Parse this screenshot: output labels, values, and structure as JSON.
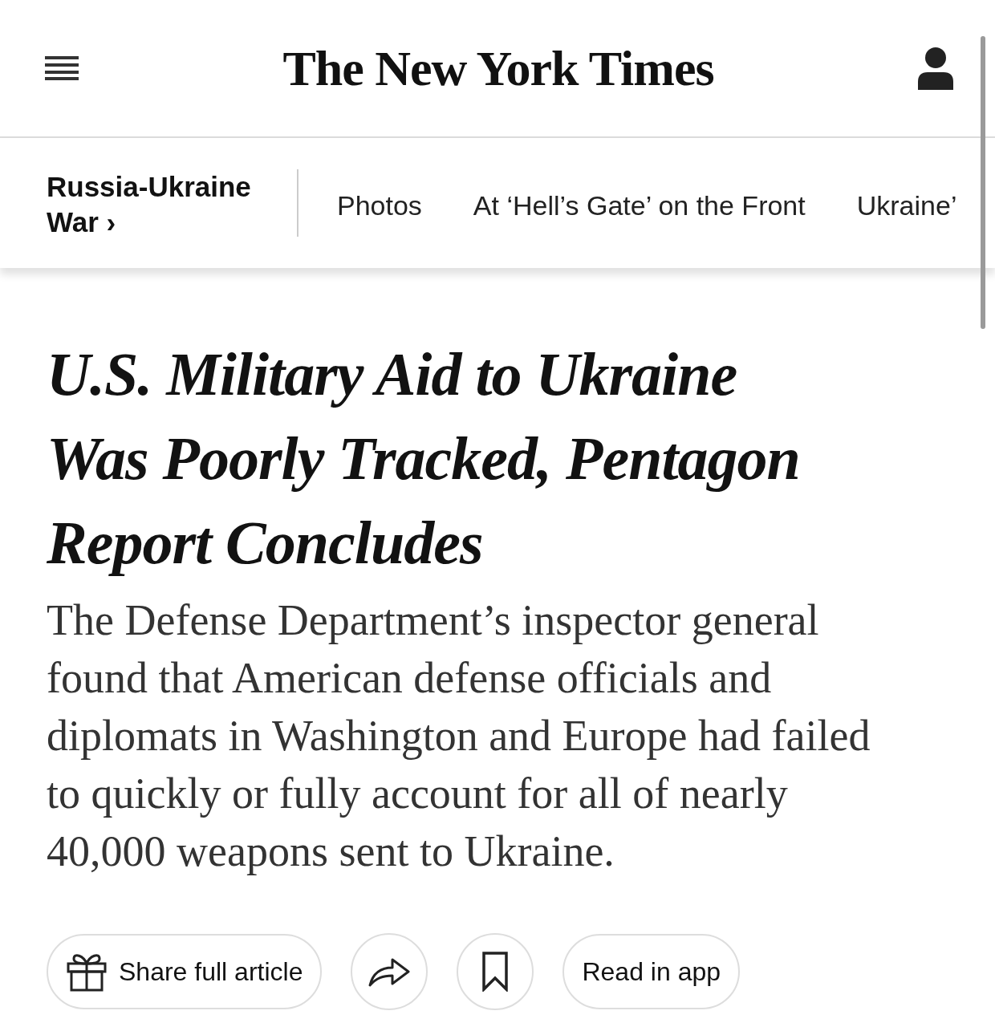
{
  "masthead": {
    "logo": "The New York Times"
  },
  "section_nav": {
    "section": "Russia-Ukraine War",
    "chevron": "›",
    "links": [
      "Photos",
      "At ‘Hell’s Gate’ on the Front",
      "Ukraine’"
    ]
  },
  "article": {
    "headline": "U.S. Military Aid to Ukraine Was Poorly Tracked, Pentagon Report Concludes",
    "summary": "The Defense Department’s inspector general found that American defense officials and diplomats in Washington and Europe had failed to quickly or fully account for all of nearly 40,000 weapons sent to Ukraine."
  },
  "actions": [
    {
      "kind": "share_article",
      "label": "Share full article"
    },
    {
      "kind": "share"
    },
    {
      "kind": "save"
    },
    {
      "kind": "app",
      "label": "Read in app"
    }
  ]
}
